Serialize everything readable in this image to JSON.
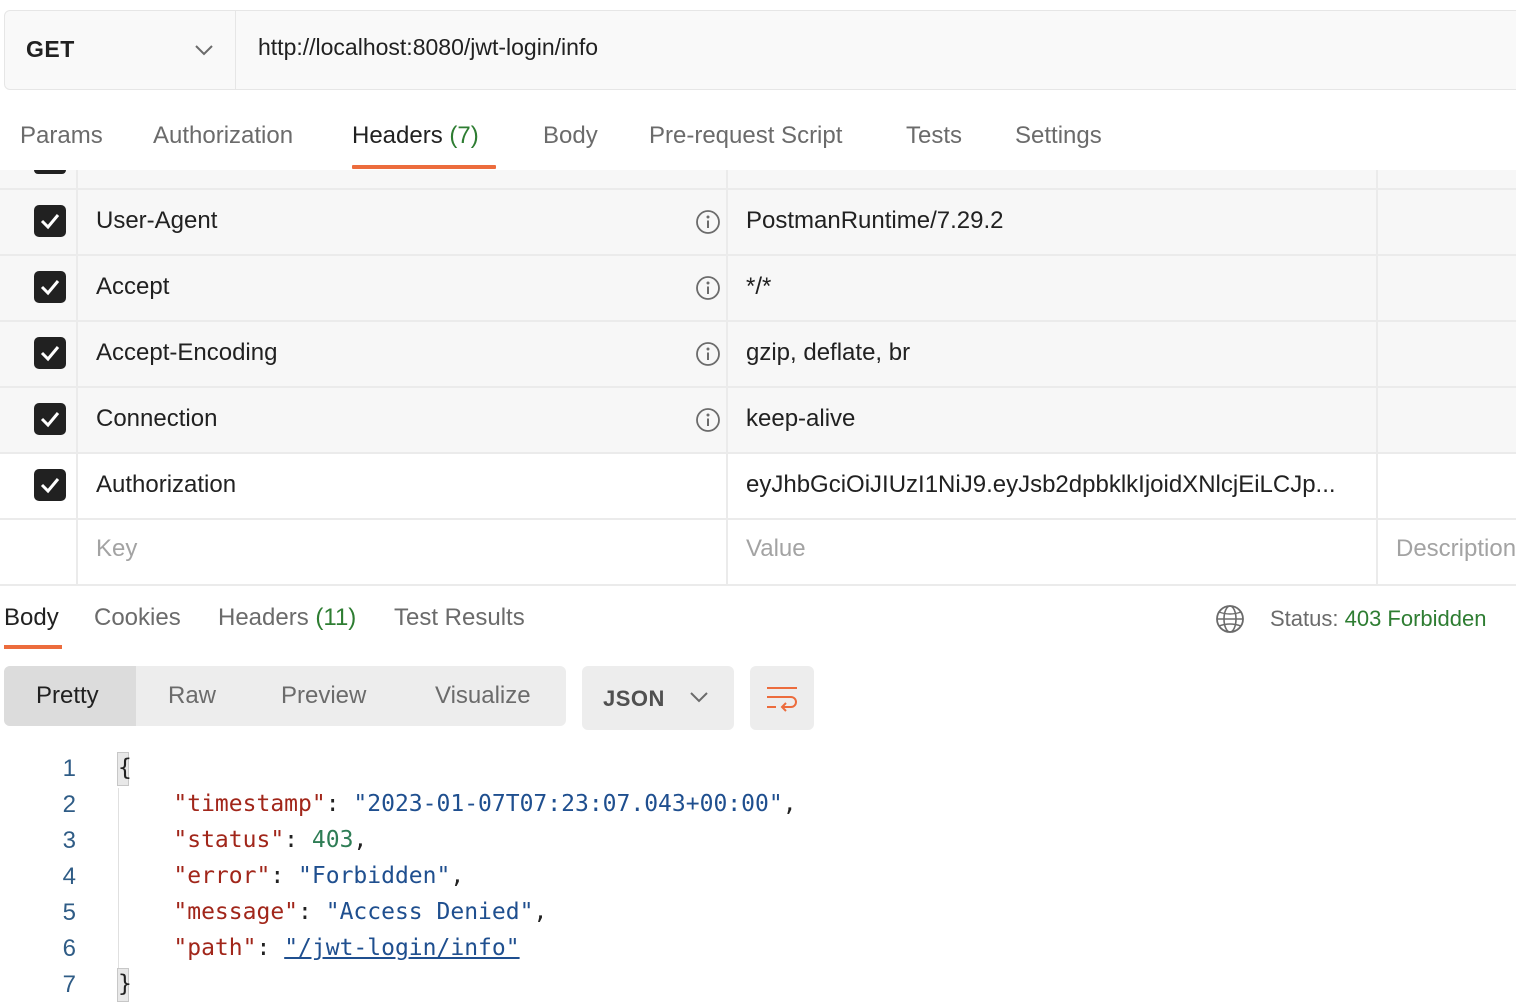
{
  "request": {
    "method": "GET",
    "url": "http://localhost:8080/jwt-login/info"
  },
  "request_tabs": [
    {
      "label": "Params"
    },
    {
      "label": "Authorization"
    },
    {
      "label": "Headers",
      "count": "(7)"
    },
    {
      "label": "Body"
    },
    {
      "label": "Pre-request Script"
    },
    {
      "label": "Tests"
    },
    {
      "label": "Settings"
    }
  ],
  "active_request_tab": "Headers",
  "headers": [
    {
      "checked": true,
      "key": "User-Agent",
      "value": "PostmanRuntime/7.29.2",
      "auto": true
    },
    {
      "checked": true,
      "key": "Accept",
      "value": "*/*",
      "auto": true
    },
    {
      "checked": true,
      "key": "Accept-Encoding",
      "value": "gzip, deflate, br",
      "auto": true
    },
    {
      "checked": true,
      "key": "Connection",
      "value": "keep-alive",
      "auto": true
    },
    {
      "checked": true,
      "key": "Authorization",
      "value": "eyJhbGciOiJIUzI1NiJ9.eyJsb2dpbklkIjoidXNlcjEiLCJp...",
      "auto": false
    }
  ],
  "new_header_placeholders": {
    "key": "Key",
    "value": "Value",
    "description": "Description"
  },
  "response_tabs": [
    {
      "label": "Body"
    },
    {
      "label": "Cookies"
    },
    {
      "label": "Headers",
      "count": "(11)"
    },
    {
      "label": "Test Results"
    }
  ],
  "active_response_tab": "Body",
  "status": {
    "label": "Status:",
    "code": "403 Forbidden"
  },
  "view_modes": [
    "Pretty",
    "Raw",
    "Preview",
    "Visualize"
  ],
  "active_view_mode": "Pretty",
  "format": "JSON",
  "icons": {
    "method_dropdown": "chevron-down-icon",
    "globe": "globe-icon",
    "wrap": "text-wrap-icon",
    "info": "info-icon",
    "checkbox": "check-icon"
  },
  "colors": {
    "accent": "#ec6c3d",
    "success_green": "#2e7d32",
    "json_key": "#a1261a",
    "json_string": "#1f4f8f",
    "json_number": "#2e7d55"
  },
  "response_body": {
    "line_numbers": [
      "1",
      "2",
      "3",
      "4",
      "5",
      "6",
      "7"
    ],
    "open_brace": "{",
    "close_brace": "}",
    "fields": [
      {
        "key": "\"timestamp\"",
        "value": "\"2023-01-07T07:23:07.043+00:00\"",
        "type": "string",
        "comma": ","
      },
      {
        "key": "\"status\"",
        "value": "403",
        "type": "number",
        "comma": ","
      },
      {
        "key": "\"error\"",
        "value": "\"Forbidden\"",
        "type": "string",
        "comma": ","
      },
      {
        "key": "\"message\"",
        "value": "\"Access Denied\"",
        "type": "string",
        "comma": ","
      },
      {
        "key": "\"path\"",
        "value": "\"/jwt-login/info\"",
        "type": "link",
        "comma": ""
      }
    ]
  }
}
